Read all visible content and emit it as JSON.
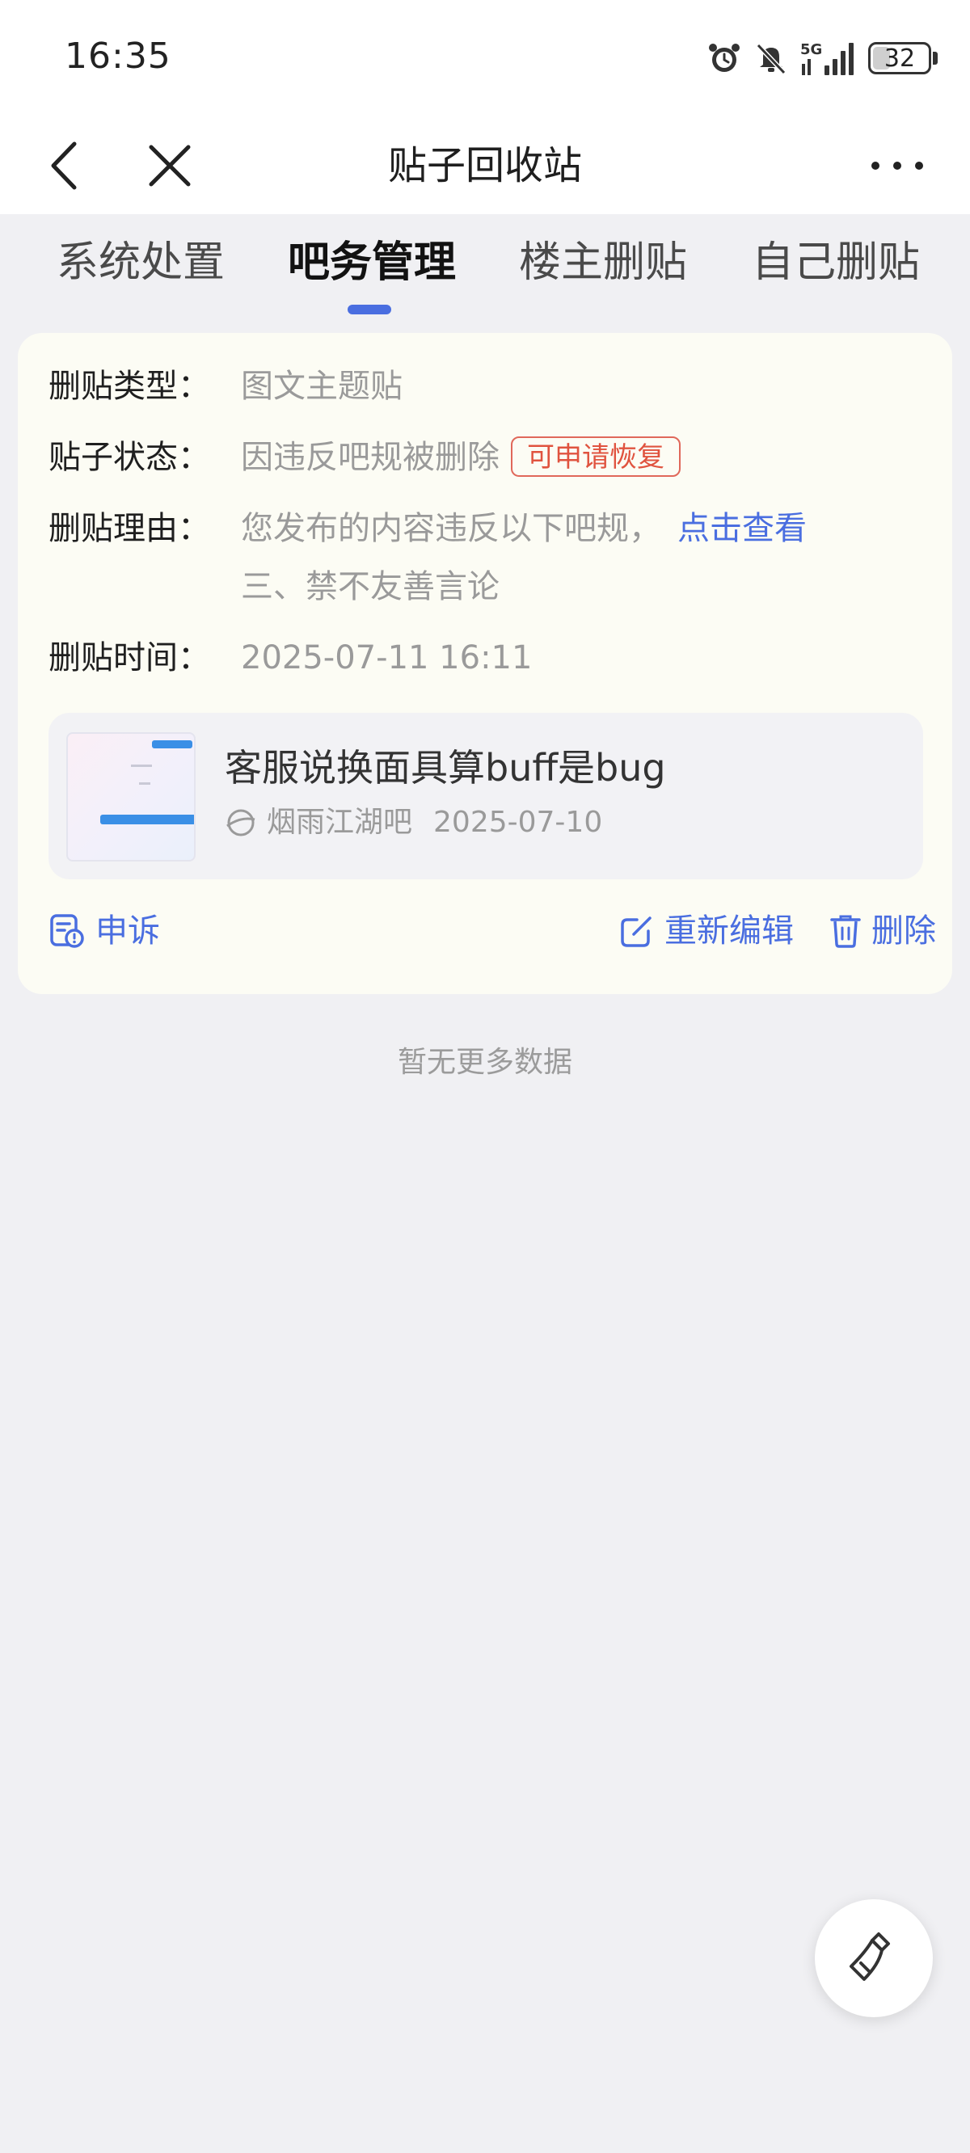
{
  "status_bar": {
    "time": "16:35",
    "network": "5G",
    "battery": "32",
    "battery_level": 0.32,
    "icons": [
      "alarm-icon",
      "mute-icon",
      "signal-icon",
      "battery-icon"
    ]
  },
  "nav": {
    "title": "贴子回收站",
    "icons": [
      "back-icon",
      "close-icon",
      "more-icon"
    ]
  },
  "tabs": [
    {
      "label": "系统处置",
      "active": false
    },
    {
      "label": "吧务管理",
      "active": true
    },
    {
      "label": "楼主删贴",
      "active": false
    },
    {
      "label": "自己删贴",
      "active": false
    }
  ],
  "record": {
    "type_label": "删贴类型：",
    "type_value": "图文主题贴",
    "status_label": "贴子状态：",
    "status_value": "因违反吧规被删除",
    "status_badge": "可申请恢复",
    "reason_label": "删贴理由：",
    "reason_value": "您发布的内容违反以下吧规，",
    "reason_link": "点击查看",
    "reason_detail": "三、禁不友善言论",
    "time_label": "删贴时间：",
    "time_value": "2025-07-11 16:11",
    "post": {
      "title": "客服说换面具算buff是bug",
      "forum": "烟雨江湖吧",
      "date": "2025-07-10"
    },
    "actions": {
      "appeal": "申诉",
      "reedit": "重新编辑",
      "delete": "删除"
    }
  },
  "footer": {
    "no_more": "暂无更多数据"
  },
  "colors": {
    "accent": "#4a6ee0",
    "badge": "#e0533f",
    "card_bg": "#fcfcf4",
    "page_bg": "#f0f0f3"
  }
}
